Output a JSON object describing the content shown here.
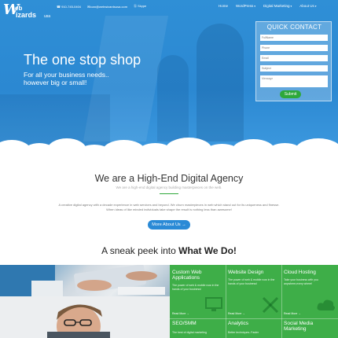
{
  "brand": {
    "logo_w": "W",
    "logo_eb": "eb",
    "logo_izards": "izards",
    "logo_usa": "usa"
  },
  "contact_bar": {
    "phone": "910-745-0404",
    "email": "loan@webwizardsusa.com",
    "skype": "Skype"
  },
  "nav": [
    {
      "label": "Home"
    },
    {
      "label": "WordPress"
    },
    {
      "label": "Digital Marketing"
    },
    {
      "label": "About Us"
    }
  ],
  "hero": {
    "headline": "The one stop shop",
    "sub1": "For all your business needs..",
    "sub2": "however big or small!"
  },
  "quick_contact": {
    "title": "QUICK CONTACT",
    "fields": [
      {
        "placeholder": "FullName"
      },
      {
        "placeholder": "Phone"
      },
      {
        "placeholder": "Email"
      },
      {
        "placeholder": "Subject"
      }
    ],
    "message_placeholder": "Message",
    "submit_label": "Submit"
  },
  "agency": {
    "title": "We are a High-End Digital Agency",
    "subtitle": "We are a high-end digital agency building masterpieces on the web.",
    "paragraph": "A creative digital agency with a decade experience in web services and beyond. We churn masterpieces in web which stand out for its uniqueness and finesse. When ideas of like minded individuals take shape the result is nothing less than awesome!",
    "button_label": "More About Us →"
  },
  "peek": {
    "prefix": "A sneak peek into ",
    "bold": "What We Do!"
  },
  "services": [
    {
      "title": "Custom Web Applications",
      "desc": "The power of web & mobile now in the hands of your business!",
      "more": "Read More →",
      "icon": "monitor-icon"
    },
    {
      "title": "Website Design",
      "desc": "The power of web & mobile now in the hands of your business!",
      "more": "Read More →",
      "icon": "design-tools-icon"
    },
    {
      "title": "Cloud Hosting",
      "desc": "Take your business with you anywhere,every where!",
      "more": "Read More →",
      "icon": "cloud-icon"
    },
    {
      "title": "SEO/SMM",
      "desc": "The best of digital marketing",
      "more": "",
      "icon": "seo-icon"
    },
    {
      "title": "Analytics",
      "desc": "Better techniques..Faster",
      "more": "",
      "icon": "analytics-icon"
    },
    {
      "title": "Social Media Marketing",
      "desc": "",
      "more": "",
      "icon": "social-icon"
    }
  ],
  "colors": {
    "hero_blue": "#2b88d2",
    "accent_green": "#3eae48",
    "button_blue": "#2a8ad6"
  }
}
